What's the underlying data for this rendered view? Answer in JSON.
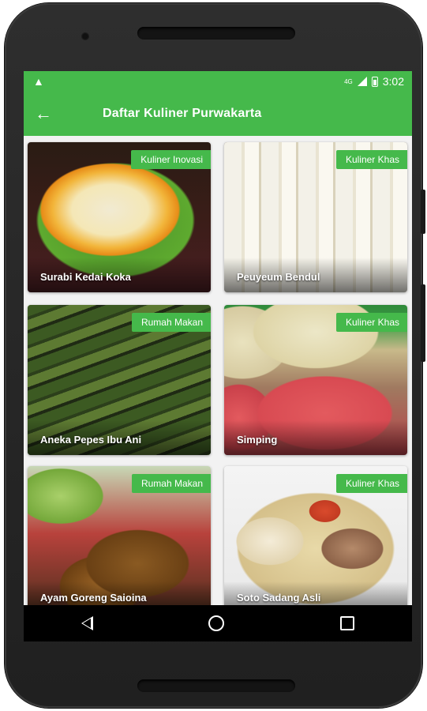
{
  "status_bar": {
    "warning_icon": "warning-icon",
    "network": "4G",
    "time": "3:02"
  },
  "app_bar": {
    "back_icon": "arrow-back-icon",
    "title": "Daftar Kuliner Purwakarta"
  },
  "colors": {
    "primary": "#45b94b",
    "screen_bg": "#f2f2f2",
    "nav_bg": "#000000"
  },
  "cards": [
    {
      "title": "Surabi Kedai Koka",
      "tag": "Kuliner Inovasi"
    },
    {
      "title": "Peuyeum Bendul",
      "tag": "Kuliner Khas"
    },
    {
      "title": "Aneka Pepes Ibu Ani",
      "tag": "Rumah Makan"
    },
    {
      "title": "Simping",
      "tag": "Kuliner Khas"
    },
    {
      "title": "Ayam Goreng Saioina",
      "tag": "Rumah Makan"
    },
    {
      "title": "Soto Sadang Asli",
      "tag": "Kuliner Khas"
    }
  ],
  "nav_bar": {
    "back": "nav-back-icon",
    "home": "nav-home-icon",
    "recent": "nav-recent-icon"
  }
}
